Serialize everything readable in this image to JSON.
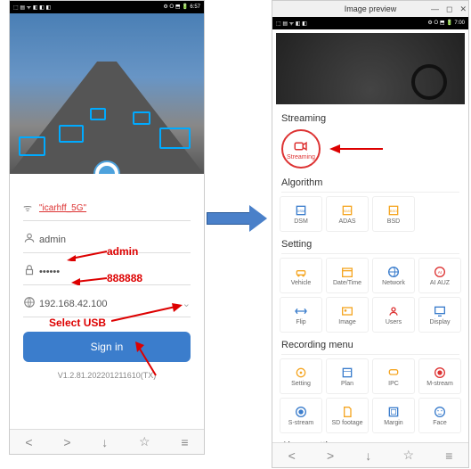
{
  "left": {
    "status_time": "6:57",
    "wifi_name": "\"icarhff_5G\"",
    "username": "admin",
    "password_dots": "••••••",
    "ip": "192.168.42.100",
    "signin_label": "Sign    in",
    "version": "V1.2.81.202201211610(TX)"
  },
  "annotations": {
    "admin": "admin",
    "pwd_hint": "888888",
    "select_usb": "Select USB"
  },
  "right": {
    "window_title": "Image preview",
    "status_time": "7:00",
    "sections": {
      "streaming": "Streaming",
      "algorithm": "Algorithm",
      "setting": "Setting",
      "recording": "Recording menu",
      "alarm": "Alarm setting"
    },
    "streaming_label": "Streaming",
    "algorithm_tiles": [
      "DSM",
      "ADAS",
      "BSD"
    ],
    "setting_tiles": [
      "Vehicle",
      "Date/Time",
      "Network",
      "AI AUZ",
      "Flip",
      "Image",
      "Users",
      "Display"
    ],
    "recording_tiles": [
      "Setting",
      "Plan",
      "IPC",
      "M-stream",
      "S-stream",
      "SD footage",
      "Margin",
      "Face"
    ]
  },
  "colors": {
    "accent_blue": "#3b7dcc",
    "accent_orange": "#f5a623",
    "accent_red": "#d33"
  }
}
